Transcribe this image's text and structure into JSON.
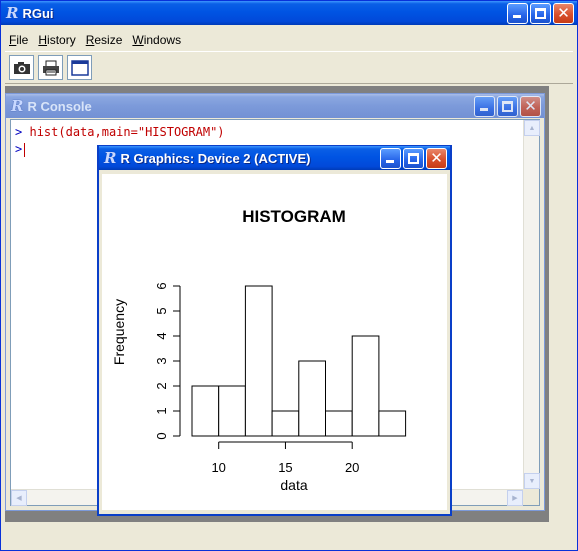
{
  "app": {
    "title": "RGui",
    "logo": "R"
  },
  "menu": [
    {
      "mnemonic": "F",
      "rest": "ile"
    },
    {
      "mnemonic": "H",
      "rest": "istory"
    },
    {
      "mnemonic": "R",
      "rest": "esize"
    },
    {
      "mnemonic": "W",
      "rest": "indows"
    }
  ],
  "toolbar": {
    "icons": [
      "camera-icon",
      "printer-icon",
      "window-icon"
    ]
  },
  "console": {
    "title": "R Console",
    "prompt": ">",
    "lines": [
      "hist(data,main=\"HISTOGRAM\")",
      ""
    ]
  },
  "graphics": {
    "title": "R Graphics: Device 2 (ACTIVE)"
  },
  "chart_data": {
    "type": "bar",
    "title": "HISTOGRAM",
    "xlabel": "data",
    "ylabel": "Frequency",
    "bins": [
      [
        8,
        10
      ],
      [
        10,
        12
      ],
      [
        12,
        14
      ],
      [
        14,
        16
      ],
      [
        16,
        18
      ],
      [
        18,
        20
      ],
      [
        20,
        22
      ],
      [
        22,
        24
      ]
    ],
    "values": [
      2,
      2,
      6,
      1,
      3,
      1,
      4,
      1
    ],
    "xticks": [
      10,
      15,
      20
    ],
    "yticks": [
      0,
      1,
      2,
      3,
      4,
      5,
      6
    ],
    "xlim": [
      10,
      20
    ],
    "ylim": [
      0,
      6
    ]
  },
  "colors": {
    "titlebar_active": "#0054e3",
    "titlebar_inactive": "#7c9ada",
    "prompt": "#0000c0",
    "command": "#c00000",
    "desktop": "#808080"
  }
}
